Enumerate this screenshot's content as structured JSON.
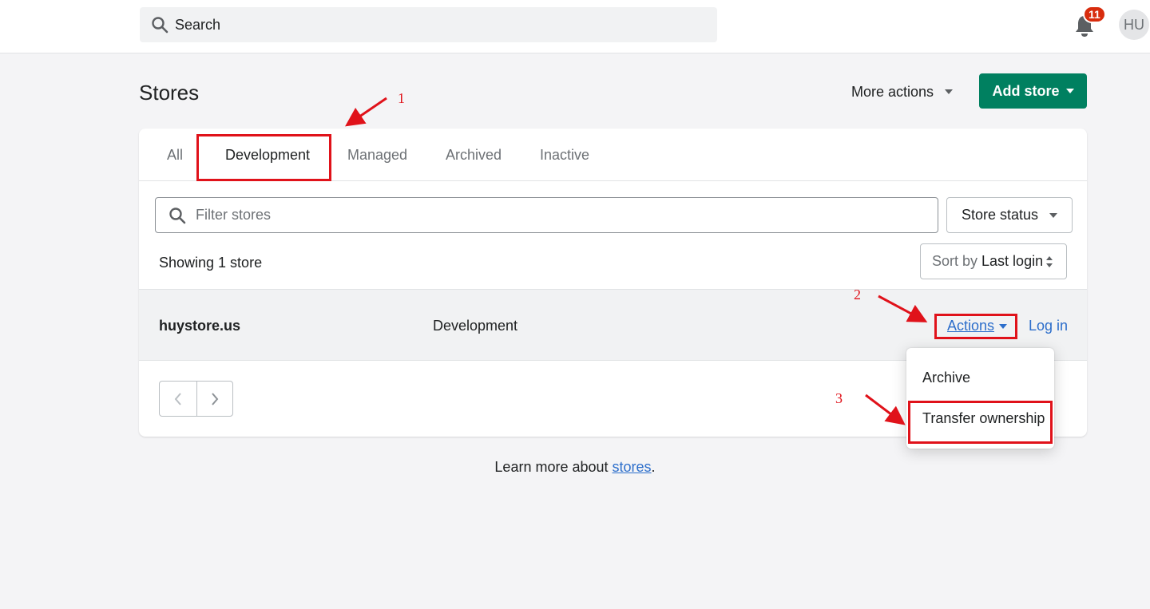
{
  "topbar": {
    "search_placeholder": "Search",
    "notification_count": "11",
    "avatar_initials": "HU"
  },
  "page": {
    "title": "Stores",
    "more_actions_label": "More actions",
    "add_store_label": "Add store"
  },
  "tabs": [
    {
      "label": "All"
    },
    {
      "label": "Development"
    },
    {
      "label": "Managed"
    },
    {
      "label": "Archived"
    },
    {
      "label": "Inactive"
    }
  ],
  "filter": {
    "placeholder": "Filter stores",
    "status_label": "Store status"
  },
  "list": {
    "showing_text": "Showing 1 store",
    "sort_label": "Sort by",
    "sort_value": "Last login",
    "rows": [
      {
        "name": "huystore.us",
        "type": "Development",
        "actions_label": "Actions",
        "login_label": "Log in"
      }
    ]
  },
  "dropdown": {
    "items": [
      {
        "label": "Archive"
      },
      {
        "label": "Transfer ownership"
      }
    ]
  },
  "footer": {
    "learn_text": "Learn more about",
    "learn_link": "stores",
    "learn_suffix": "."
  },
  "annotations": {
    "step1": "1",
    "step2": "2",
    "step3": "3"
  },
  "colors": {
    "primary": "#008060",
    "link": "#2c6ecb",
    "badge": "#d82c0d",
    "annotation": "#e0121a"
  }
}
